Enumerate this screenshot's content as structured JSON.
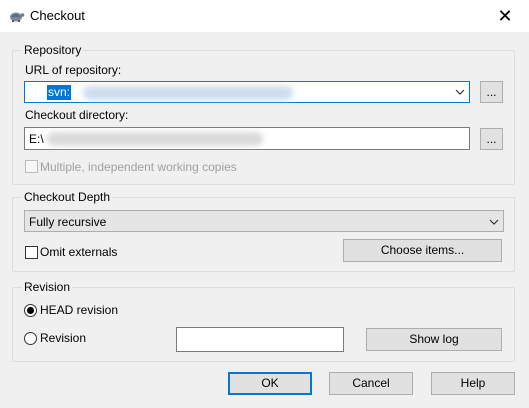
{
  "window": {
    "title": "Checkout",
    "close_glyph": "✕"
  },
  "repository": {
    "group_label": "Repository",
    "url_label": "URL of repository:",
    "url_value_prefix": "svn:",
    "browse_label": "...",
    "dir_label": "Checkout directory:",
    "dir_value_prefix": "E:\\",
    "dir_browse_label": "...",
    "multiple_label": "Multiple, independent working copies"
  },
  "depth": {
    "group_label": "Checkout Depth",
    "selected": "Fully recursive",
    "omit_externals_label": "Omit externals",
    "choose_items_label": "Choose items..."
  },
  "revision": {
    "group_label": "Revision",
    "head_label": "HEAD revision",
    "revision_label": "Revision",
    "revision_value": "",
    "show_log_label": "Show log"
  },
  "buttons": {
    "ok": "OK",
    "cancel": "Cancel",
    "help": "Help"
  },
  "colors": {
    "accent": "#0078d7",
    "background": "#f0f0f0"
  },
  "icons": {
    "app": "tortoisesvn-icon",
    "close": "close-icon",
    "dropdown": "chevron-down-icon"
  }
}
